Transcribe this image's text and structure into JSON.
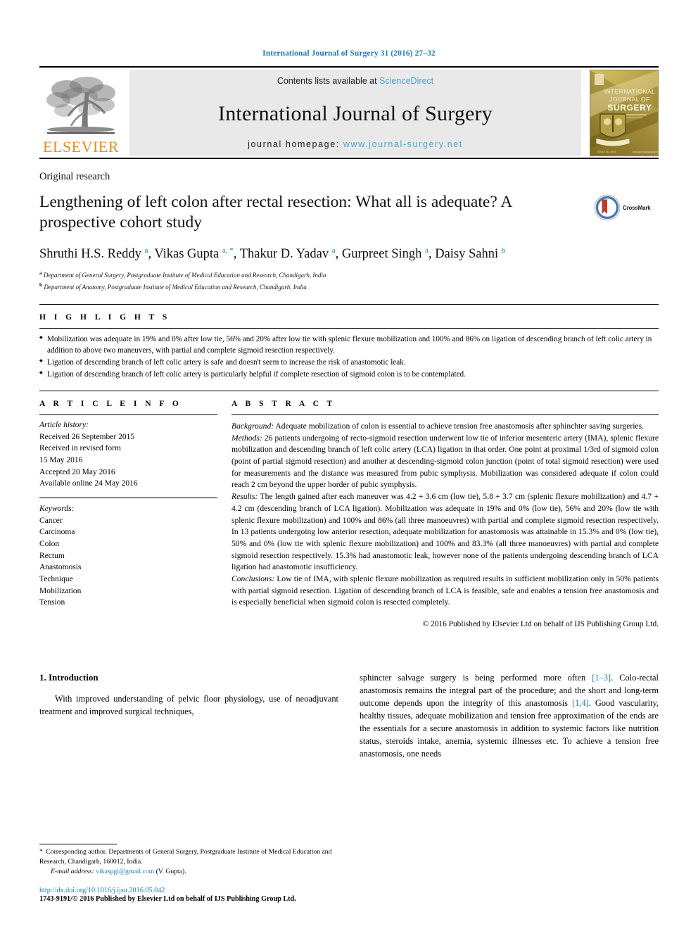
{
  "running_head": "International Journal of Surgery 31 (2016) 27–32",
  "masthead": {
    "elsevier_wordmark": "ELSEVIER",
    "contents_prefix": "Contents lists available at ",
    "sciencedirect": "ScienceDirect",
    "journal_title": "International Journal of Surgery",
    "homepage_prefix": "journal homepage: ",
    "homepage_url": "www.journal-surgery.net",
    "cover_lines": [
      "INTERNATIONAL",
      "JOURNAL OF",
      "SURGERY"
    ],
    "link_color": "#4ba3d3",
    "elsevier_orange": "#f08a1c"
  },
  "article": {
    "kind": "Original research",
    "title": "Lengthening of left colon after rectal resection: What all is adequate? A prospective cohort study",
    "crossmark_label": "CrossMark",
    "authors_html": "Shruthi H.S. Reddy <sup>a</sup>, Vikas Gupta <sup>a, *</sup>, Thakur D. Yadav <sup>a</sup>, Gurpreet Singh <sup>a</sup>, Daisy Sahni <sup>b</sup>",
    "affiliations": [
      {
        "marker": "a",
        "text": "Department of General Surgery, Postgraduate Institute of Medical Education and Research, Chandigarh, India"
      },
      {
        "marker": "b",
        "text": "Department of Anatomy, Postgraduate Institute of Medical Education and Research, Chandigarh, India"
      }
    ]
  },
  "highlights": {
    "heading": "H I G H L I G H T S",
    "items": [
      "Mobilization was adequate in 19% and 0% after low tie, 56% and 20% after low tie with splenic flexure mobilization and 100% and 86% on ligation of descending branch of left colic artery in addition to above two maneuvers, with partial and complete sigmoid resection respectively.",
      "Ligation of descending branch of left colic artery is safe and doesn't seem to increase the risk of anastomotic leak.",
      "Ligation of descending branch of left colic artery is particularly helpful if complete resection of sigmoid colon is to be contemplated."
    ]
  },
  "article_info": {
    "heading": "A R T I C L E  I N F O",
    "history_label": "Article history:",
    "history": [
      "Received 26 September 2015",
      "Received in revised form",
      "15 May 2016",
      "Accepted 20 May 2016",
      "Available online 24 May 2016"
    ],
    "keywords_label": "Keywords:",
    "keywords": [
      "Cancer",
      "Carcinoma",
      "Colon",
      "Rectum",
      "Anastomosis",
      "Technique",
      "Mobilization",
      "Tension"
    ]
  },
  "abstract": {
    "heading": "A B S T R A C T",
    "sections": [
      {
        "label": "Background:",
        "text": " Adequate mobilization of colon is essential to achieve tension free anastomosis after sphinchter saving surgeries."
      },
      {
        "label": "Methods:",
        "text": " 26 patients undergoing of recto-sigmoid resection underwent low tie of inferior mesenteric artery (IMA), splenic flexure mobilization and descending branch of left colic artery (LCA) ligation in that order. One point at proximal 1/3rd of sigmoid colon (point of partial sigmoid resection) and another at descending-sigmoid colon junction (point of total sigmoid resection) were used for measurements and the distance was measured from pubic symphysis. Mobilization was considered adequate if colon could reach 2 cm beyond the upper border of pubic symphysis."
      },
      {
        "label": "Results:",
        "text": " The length gained after each maneuver was 4.2 + 3.6 cm (low tie), 5.8 + 3.7 cm (splenic flexure mobilization) and 4.7 + 4.2 cm (descending branch of LCA ligation). Mobilization was adequate in 19% and 0% (low tie), 56% and 20% (low tie with splenic flexure mobilization) and 100% and 86% (all three manoeuvres) with partial and complete sigmoid resection respectively. In 13 patients undergoing low anterior resection, adequate mobilization for anastomosis was attainable in 15.3% and 0% (low tie), 50% and 0% (low tie with splenic flexure mobilization) and 100% and 83.3% (all three manoeuvres) with partial and complete sigmoid resection respectively. 15.3% had anastomotic leak, however none of the patients undergoing descending branch of LCA ligation had anastomotic insufficiency."
      },
      {
        "label": "Conclusions:",
        "text": " Low tie of IMA, with splenic flexure mobilization as required results in sufficient mobilization only in 50% patients with partial sigmoid resection. Ligation of descending branch of LCA is feasible, safe and enables a tension free anastomosis and is especially beneficial when sigmoid colon is resected completely."
      }
    ],
    "copyright": "© 2016 Published by Elsevier Ltd on behalf of IJS Publishing Group Ltd."
  },
  "body": {
    "intro_heading": "1. Introduction",
    "left_paragraph": "With improved understanding of pelvic floor physiology, use of neoadjuvant treatment and improved surgical techniques,",
    "right_paragraph_parts": [
      "sphincter salvage surgery is being performed more often ",
      "[1–3]",
      ". Colo-rectal anastomosis remains the integral part of the procedure; and the short and long-term outcome depends upon the integrity of this anastomosis ",
      "[1,4]",
      ". Good vascularity, healthy tissues, adequate mobilization and tension free approximation of the ends are the essentials for a secure anastomosis in addition to systemic factors like nutrition status, steroids intake, anemia, systemic illnesses etc. To achieve a tension free anastomosis, one needs"
    ]
  },
  "footer": {
    "corresponding_star": "*",
    "corresponding_text": " Corresponding author. Departments of General Surgery, Postgraduate Institute of Medical Education and Research, Chandigarh, 160012, India.",
    "email_label": "E-mail address:",
    "email": "vikaspgi@gmail.com",
    "email_suffix": " (V. Gupta).",
    "doi": "http://dx.doi.org/10.1016/j.ijsu.2016.05.042",
    "issn_line": "1743-9191/© 2016 Published by Elsevier Ltd on behalf of IJS Publishing Group Ltd."
  }
}
